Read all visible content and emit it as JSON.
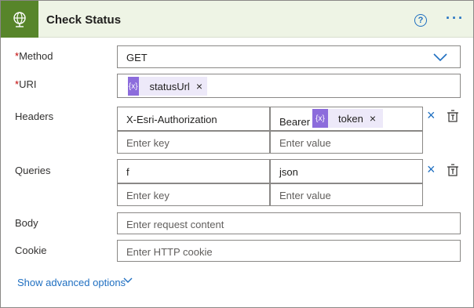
{
  "header": {
    "title": "Check Status",
    "help_icon": "question-circle-icon",
    "more_icon": "ellipsis-icon",
    "icon": "globe-icon",
    "accent": "#57852a"
  },
  "method": {
    "label": "Method",
    "required_mark": "*",
    "value": "GET"
  },
  "uri": {
    "label": "URI",
    "required_mark": "*",
    "token": "statusUrl"
  },
  "headers": {
    "label": "Headers",
    "row1_key": "X-Esri-Authorization",
    "row1_value_prefix": "Bearer",
    "row1_value_token": "token",
    "row2_key_placeholder": "Enter key",
    "row2_value_placeholder": "Enter value"
  },
  "queries": {
    "label": "Queries",
    "row1_key": "f",
    "row1_value": "json",
    "row2_key_placeholder": "Enter key",
    "row2_value_placeholder": "Enter value"
  },
  "body": {
    "label": "Body",
    "placeholder": "Enter request content"
  },
  "cookie": {
    "label": "Cookie",
    "placeholder": "Enter HTTP cookie"
  },
  "advanced": {
    "label": "Show advanced options"
  },
  "token_icon_glyph": "{x}",
  "remove_glyph": "×"
}
